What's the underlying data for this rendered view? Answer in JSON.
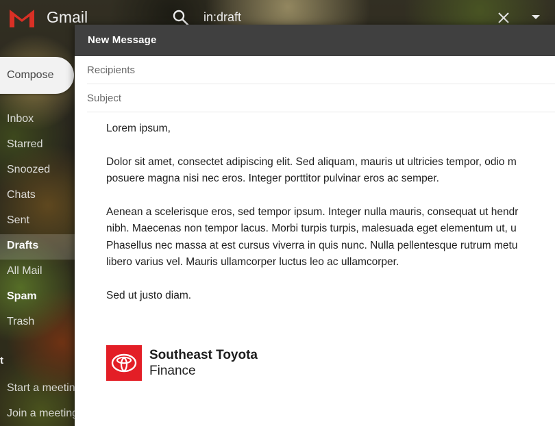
{
  "app": {
    "name": "Gmail"
  },
  "search": {
    "query": "in:draft"
  },
  "sidebar": {
    "compose_label": "Compose",
    "items": [
      {
        "label": "Inbox"
      },
      {
        "label": "Starred"
      },
      {
        "label": "Snoozed"
      },
      {
        "label": "Chats"
      },
      {
        "label": "Sent"
      },
      {
        "label": "Drafts"
      },
      {
        "label": "All Mail"
      },
      {
        "label": "Spam"
      },
      {
        "label": "Trash"
      }
    ],
    "meet_header": "t",
    "meet_items": [
      {
        "label": "Start a meeting"
      },
      {
        "label": "Join a meeting"
      }
    ]
  },
  "compose": {
    "title": "New Message",
    "recipients_placeholder": "Recipients",
    "subject_placeholder": "Subject",
    "greeting": "Lorem ipsum,",
    "paragraph1": [
      "Dolor sit amet, consectet adipiscing elit. Sed aliquam, mauris ut ultricies tempor, odio m",
      "posuere magna nisi nec eros. Integer porttitor pulvinar eros ac semper."
    ],
    "paragraph2": [
      "Aenean a scelerisque eros, sed tempor ipsum. Integer nulla mauris, consequat ut hendr",
      "nibh. Maecenas non tempor lacus. Morbi turpis turpis, malesuada eget elementum ut, u",
      "Phasellus nec massa at est cursus viverra in quis nunc. Nulla pellentesque rutrum metu",
      "libero varius vel. Mauris ullamcorper luctus leo ac ullamcorper."
    ],
    "closing": "Sed ut justo diam.",
    "signature": {
      "company_line1": "Southeast Toyota",
      "company_line2": "Finance",
      "logo_color": "#e31e26"
    }
  },
  "colors": {
    "titlebar": "#404040",
    "gmail_red": "#d93025"
  }
}
